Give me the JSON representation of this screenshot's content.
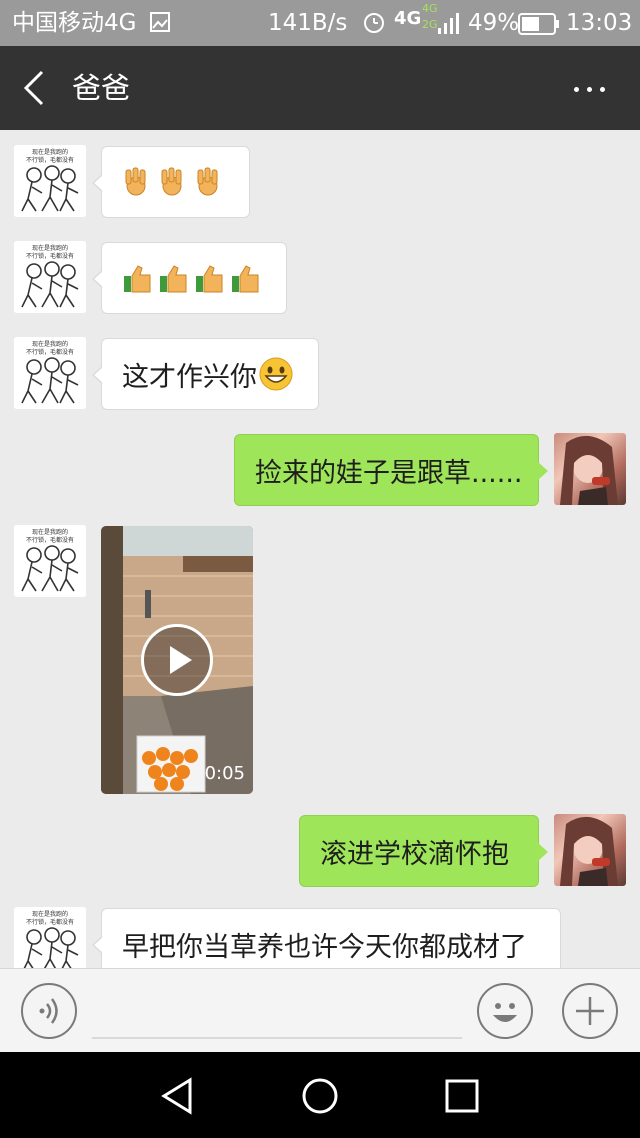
{
  "status_bar": {
    "carrier": "中国移动4G",
    "speed": "141B/s",
    "net_primary": "4G",
    "net_secondary_top": "4G",
    "net_secondary_bottom": "2G",
    "battery": "49%",
    "time": "13:03"
  },
  "header": {
    "title": "爸爸",
    "back_icon": "chevron-left-icon",
    "more_icon": "more-dots-icon"
  },
  "messages": [
    {
      "side": "left",
      "type": "emoji",
      "emoji": [
        "ok-hand",
        "ok-hand",
        "ok-hand"
      ]
    },
    {
      "side": "left",
      "type": "emoji",
      "emoji": [
        "thumbs-up",
        "thumbs-up",
        "thumbs-up",
        "thumbs-up"
      ]
    },
    {
      "side": "left",
      "type": "text",
      "text": "这才作兴你",
      "emoji_after": "grinning-face"
    },
    {
      "side": "right",
      "type": "text",
      "text": "捡来的娃子是跟草......"
    },
    {
      "side": "left",
      "type": "video",
      "duration": "0:05"
    },
    {
      "side": "right",
      "type": "text",
      "text": "滚进学校滴怀抱"
    },
    {
      "side": "left",
      "type": "text",
      "text": "早把你当草养也许今天你都成材了"
    }
  ],
  "avatar_left": {
    "caption_line1": "现在是我跑的",
    "caption_line2": "不行锁，毛都没有"
  },
  "input_bar": {
    "voice_icon": "voice-icon",
    "emoji_icon": "emoji-icon",
    "plus_icon": "plus-icon",
    "text_value": ""
  },
  "nav_bar": {
    "back_icon": "triangle-back-icon",
    "home_icon": "circle-home-icon",
    "recent_icon": "square-recent-icon"
  },
  "colors": {
    "title_bar": "#333333",
    "chat_bg": "#ebebeb",
    "bubble_right": "#9fe55a",
    "bubble_left": "#ffffff",
    "status_bar": "#9a9a9a"
  }
}
